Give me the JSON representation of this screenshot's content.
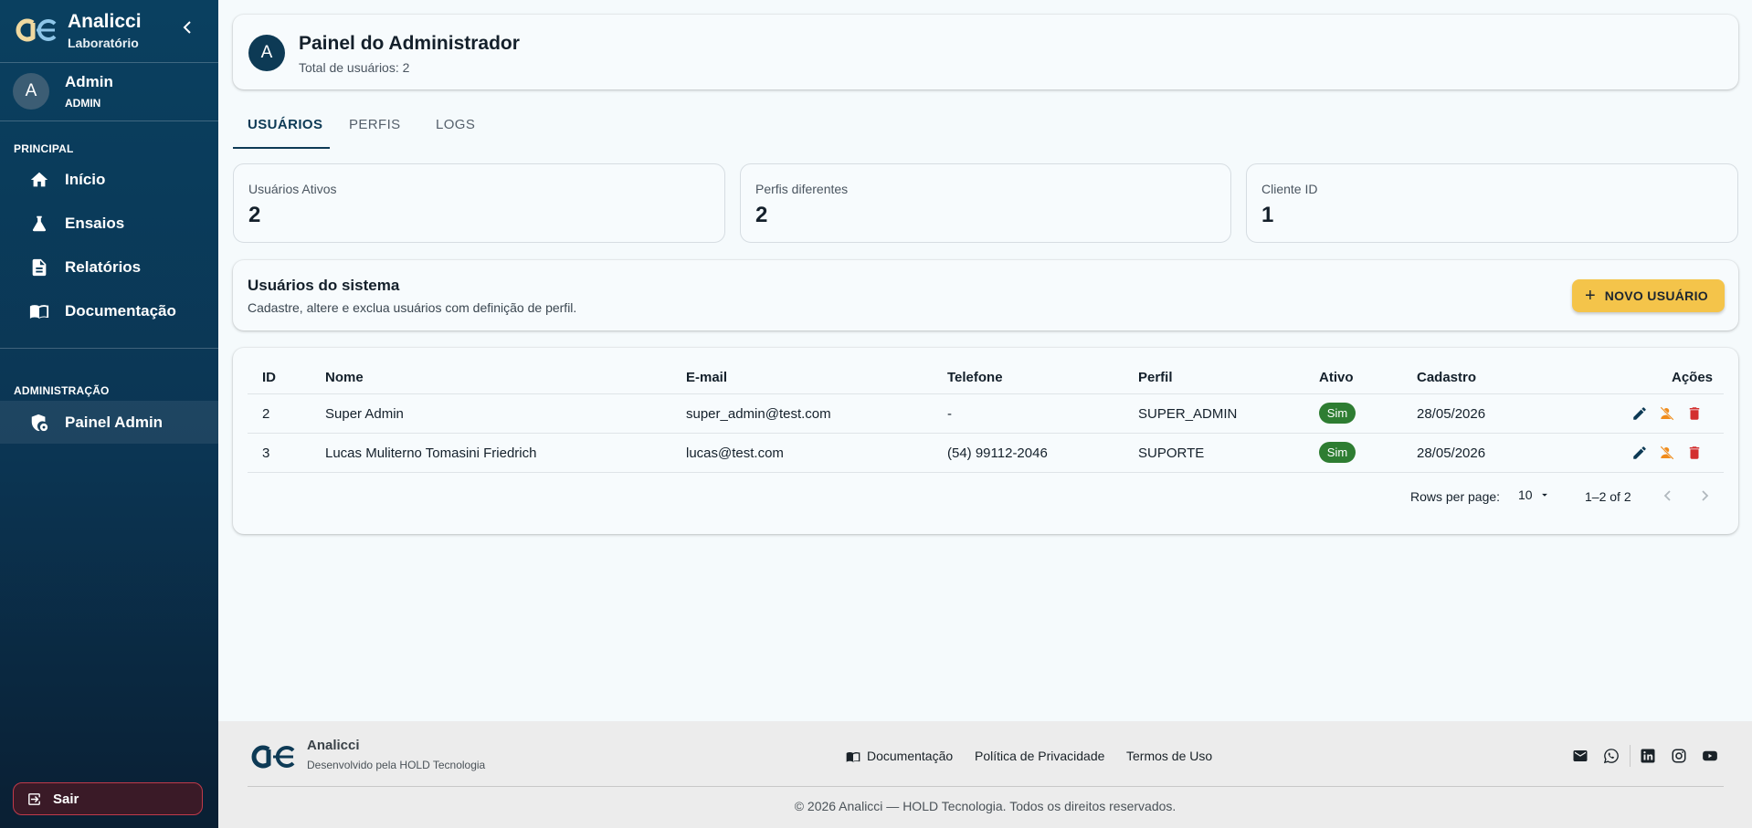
{
  "sidebar": {
    "brand_name": "Analicci",
    "brand_sub": "Laboratório",
    "user_initial": "A",
    "user_name": "Admin",
    "user_role": "ADMIN",
    "section_principal": "PRINCIPAL",
    "section_admin": "ADMINISTRAÇÃO",
    "nav": {
      "inicio": "Início",
      "ensaios": "Ensaios",
      "relatorios": "Relatórios",
      "documentacao": "Documentação",
      "painel_admin": "Painel Admin"
    },
    "logout": "Sair"
  },
  "header": {
    "initial": "A",
    "title": "Painel do Administrador",
    "subtitle": "Total de usuários: 2"
  },
  "tabs": {
    "usuarios": "USUÁRIOS",
    "perfis": "PERFIS",
    "logs": "LOGS"
  },
  "stats": [
    {
      "label": "Usuários Ativos",
      "value": "2"
    },
    {
      "label": "Perfis diferentes",
      "value": "2"
    },
    {
      "label": "Cliente ID",
      "value": "1"
    }
  ],
  "system_users": {
    "title": "Usuários do sistema",
    "subtitle": "Cadastre, altere e exclua usuários com definição de perfil.",
    "new_button": "NOVO USUÁRIO"
  },
  "table": {
    "headers": {
      "id": "ID",
      "nome": "Nome",
      "email": "E-mail",
      "telefone": "Telefone",
      "perfil": "Perfil",
      "ativo": "Ativo",
      "cadastro": "Cadastro",
      "acoes": "Ações"
    },
    "rows": [
      {
        "id": "2",
        "nome": "Super Admin",
        "email": "super_admin@test.com",
        "telefone": "-",
        "perfil": "SUPER_ADMIN",
        "ativo": "Sim",
        "cadastro": "28/05/2026"
      },
      {
        "id": "3",
        "nome": "Lucas Muliterno Tomasini Friedrich",
        "email": "lucas@test.com",
        "telefone": "(54) 99112-2046",
        "perfil": "SUPORTE",
        "ativo": "Sim",
        "cadastro": "28/05/2026"
      }
    ],
    "pagination": {
      "rows_per_page_label": "Rows per page:",
      "rows_per_page_value": "10",
      "range": "1–2 of 2"
    }
  },
  "footer": {
    "name": "Analicci",
    "sub": "Desenvolvido pela HOLD Tecnologia",
    "links": {
      "documentacao": "Documentação",
      "privacidade": "Política de Privacidade",
      "termos": "Termos de Uso"
    },
    "copyright": "© 2026 Analicci — HOLD Tecnologia. Todos os direitos reservados."
  },
  "colors": {
    "sidebar": "#0b3553",
    "accent": "#f4c44a",
    "active_badge": "#2e7d32",
    "edit_icon": "#0d3a55",
    "deactivate_icon": "#f08c1c",
    "delete_icon": "#d32f2f"
  }
}
